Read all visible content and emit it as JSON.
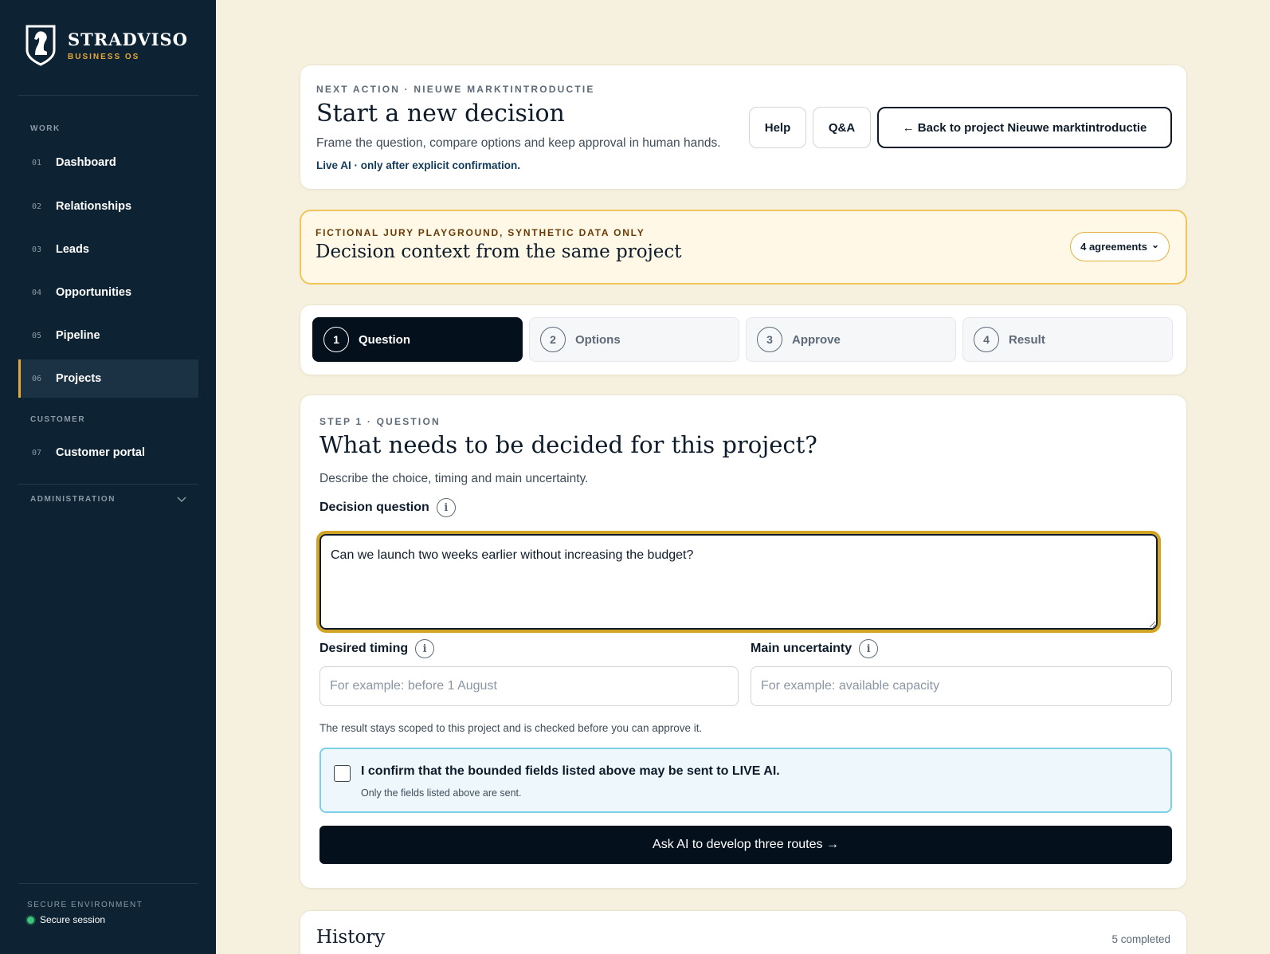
{
  "brand": {
    "name": "STRADVISO",
    "subtitle": "BUSINESS OS"
  },
  "sidebar": {
    "sections": {
      "work": "WORK",
      "customer": "CUSTOMER",
      "administration": "ADMINISTRATION"
    },
    "items": [
      {
        "num": "01",
        "label": "Dashboard"
      },
      {
        "num": "02",
        "label": "Relationships"
      },
      {
        "num": "03",
        "label": "Leads"
      },
      {
        "num": "04",
        "label": "Opportunities"
      },
      {
        "num": "05",
        "label": "Pipeline"
      },
      {
        "num": "06",
        "label": "Projects",
        "active": true
      },
      {
        "num": "07",
        "label": "Customer portal"
      }
    ],
    "footer": {
      "title": "SECURE ENVIRONMENT",
      "status": "Secure session",
      "status_color": "#3ec47c"
    }
  },
  "header": {
    "eyebrow": "NEXT ACTION · NIEUWE MARKTINTRODUCTIE",
    "title": "Start a new decision",
    "subtitle": "Frame the question, compare options and keep approval in human hands.",
    "note": "Live AI · only after explicit confirmation.",
    "buttons": {
      "help": "Help",
      "qa": "Q&A",
      "back": "← Back to project Nieuwe marktintroductie"
    }
  },
  "notice": {
    "eyebrow": "FICTIONAL JURY PLAYGROUND, SYNTHETIC DATA ONLY",
    "title": "Decision context from the same project",
    "agreements_label": "4 agreements",
    "agreements_chevron": "⌄"
  },
  "steps": [
    {
      "num": "1",
      "label": "Question",
      "active": true
    },
    {
      "num": "2",
      "label": "Options"
    },
    {
      "num": "3",
      "label": "Approve"
    },
    {
      "num": "4",
      "label": "Result"
    }
  ],
  "form": {
    "eyebrow": "STEP 1 · QUESTION",
    "title": "What needs to be decided for this project?",
    "subtitle": "Describe the choice, timing and main uncertainty.",
    "question_label": "Decision question",
    "question_value": "Can we launch two weeks earlier without increasing the budget?",
    "timing_label": "Desired timing",
    "timing_placeholder": "For example: before 1 August",
    "uncertainty_label": "Main uncertainty",
    "uncertainty_placeholder": "For example: available capacity",
    "scope_note": "The result stays scoped to this project and is checked before you can approve it.",
    "confirm_label": "I confirm that the bounded fields listed above may be sent to LIVE AI.",
    "confirm_sub": "Only the fields listed above are sent.",
    "submit_label": "Ask AI to develop three routes →",
    "info_glyph": "i"
  },
  "history": {
    "title": "History",
    "count": "5 completed"
  },
  "colors": {
    "accent": "#e8a838",
    "sidebar": "#0d2333",
    "background": "#f6f0df",
    "focus": "#d3a424"
  }
}
